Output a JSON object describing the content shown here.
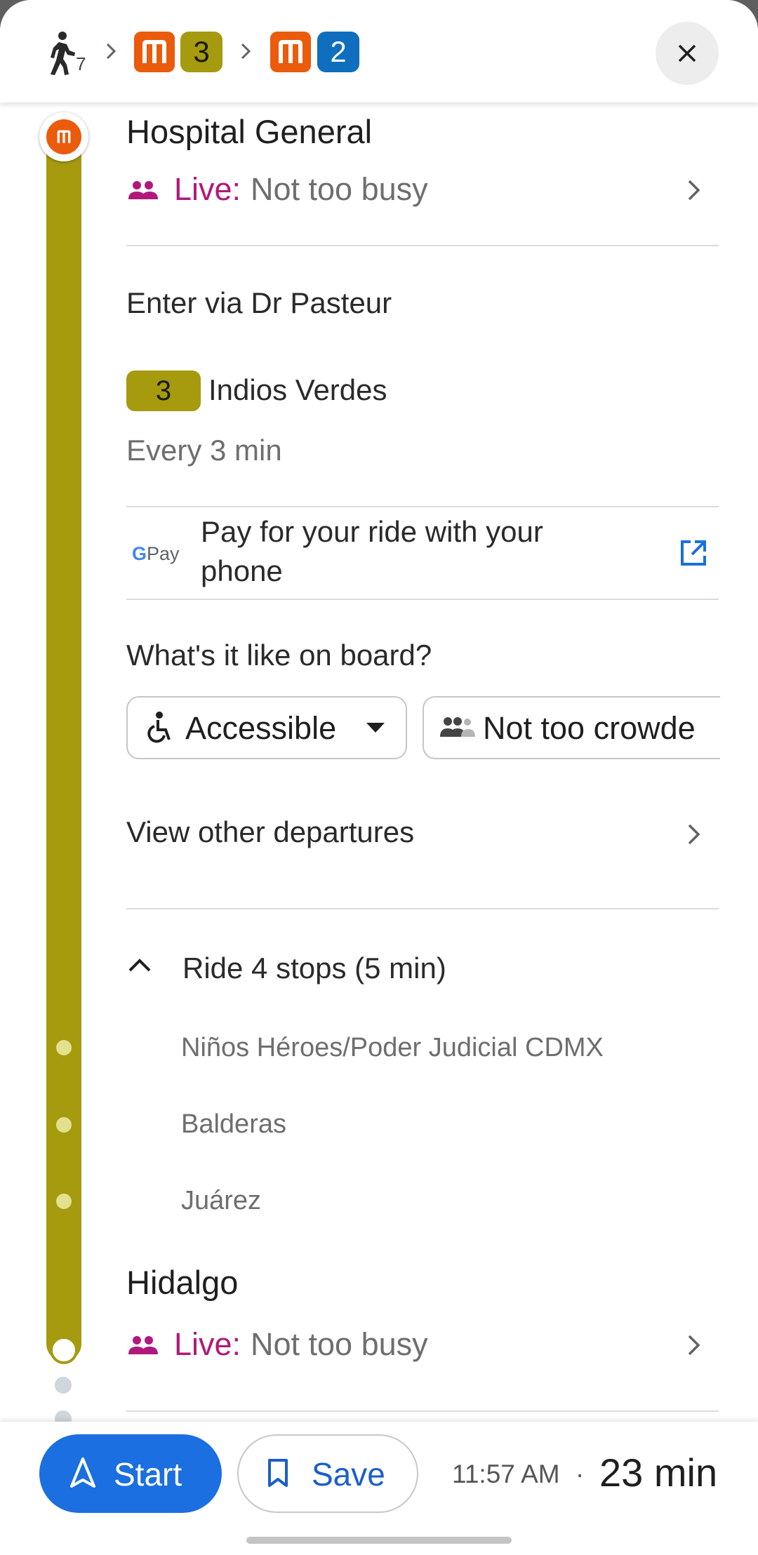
{
  "header": {
    "walk_minutes": "7",
    "route_lines": [
      "3",
      "2"
    ],
    "colors": {
      "metro": "#ea5b0c",
      "line3": "#a69a0f",
      "line2": "#0f6fbe"
    }
  },
  "origin": {
    "station": "Hospital General",
    "live_label": "Live:",
    "live_status": "Not too busy"
  },
  "entrance": "Enter via Dr Pasteur",
  "line": {
    "number": "3",
    "direction": "Indios Verdes",
    "frequency": "Every 3 min"
  },
  "payment": {
    "provider": "G Pay",
    "text_line1": "Pay for your ride with your",
    "text_line2": "phone"
  },
  "onboard": {
    "question": "What's it like on board?",
    "chips": [
      {
        "label": "Accessible"
      },
      {
        "label": "Not too crowde"
      }
    ]
  },
  "other_departures": "View other departures",
  "ride": {
    "summary": "Ride 4 stops (5 min)",
    "stops": [
      "Niños Héroes/Poder Judicial CDMX",
      "Balderas",
      "Juárez"
    ]
  },
  "destination": {
    "station": "Hidalgo",
    "live_label": "Live:",
    "live_status": "Not too busy"
  },
  "bottom": {
    "start_label": "Start",
    "save_label": "Save",
    "time": "11:57 AM",
    "separator": "·",
    "duration": "23 min",
    "accent": "#1b6fe0"
  }
}
